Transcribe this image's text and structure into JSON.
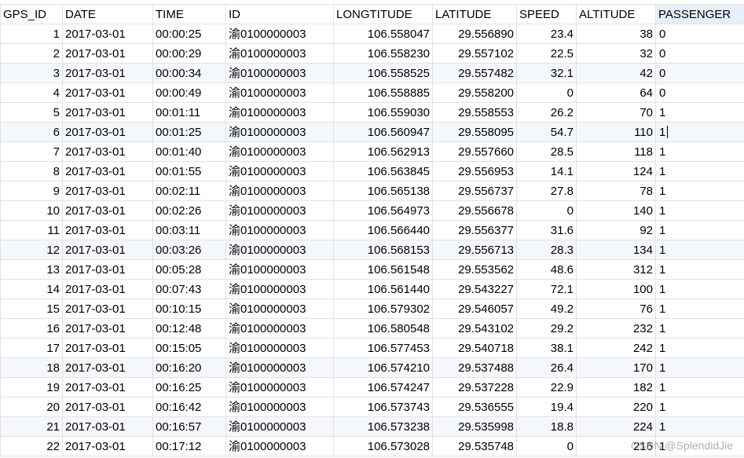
{
  "columns": [
    "GPS_ID",
    "DATE",
    "TIME",
    "ID",
    "LONGTITUDE",
    "LATITUDE",
    "SPEED",
    "ALTITUDE",
    "PASSENGER"
  ],
  "selected_column": "PASSENGER",
  "active_row_index": 5,
  "rows": [
    [
      "1",
      "2017-03-01",
      "00:00:25",
      "渝0100000003",
      "106.558047",
      "29.556890",
      "23.4",
      "38",
      "0"
    ],
    [
      "2",
      "2017-03-01",
      "00:00:29",
      "渝0100000003",
      "106.558230",
      "29.557102",
      "22.5",
      "32",
      "0"
    ],
    [
      "3",
      "2017-03-01",
      "00:00:34",
      "渝0100000003",
      "106.558525",
      "29.557482",
      "32.1",
      "42",
      "0"
    ],
    [
      "4",
      "2017-03-01",
      "00:00:49",
      "渝0100000003",
      "106.558885",
      "29.558200",
      "0",
      "64",
      "0"
    ],
    [
      "5",
      "2017-03-01",
      "00:01:11",
      "渝0100000003",
      "106.559030",
      "29.558553",
      "26.2",
      "70",
      "1"
    ],
    [
      "6",
      "2017-03-01",
      "00:01:25",
      "渝0100000003",
      "106.560947",
      "29.558095",
      "54.7",
      "110",
      "1"
    ],
    [
      "7",
      "2017-03-01",
      "00:01:40",
      "渝0100000003",
      "106.562913",
      "29.557660",
      "28.5",
      "118",
      "1"
    ],
    [
      "8",
      "2017-03-01",
      "00:01:55",
      "渝0100000003",
      "106.563845",
      "29.556953",
      "14.1",
      "124",
      "1"
    ],
    [
      "9",
      "2017-03-01",
      "00:02:11",
      "渝0100000003",
      "106.565138",
      "29.556737",
      "27.8",
      "78",
      "1"
    ],
    [
      "10",
      "2017-03-01",
      "00:02:26",
      "渝0100000003",
      "106.564973",
      "29.556678",
      "0",
      "140",
      "1"
    ],
    [
      "11",
      "2017-03-01",
      "00:03:11",
      "渝0100000003",
      "106.566440",
      "29.556377",
      "31.6",
      "92",
      "1"
    ],
    [
      "12",
      "2017-03-01",
      "00:03:26",
      "渝0100000003",
      "106.568153",
      "29.556713",
      "28.3",
      "134",
      "1"
    ],
    [
      "13",
      "2017-03-01",
      "00:05:28",
      "渝0100000003",
      "106.561548",
      "29.553562",
      "48.6",
      "312",
      "1"
    ],
    [
      "14",
      "2017-03-01",
      "00:07:43",
      "渝0100000003",
      "106.561440",
      "29.543227",
      "72.1",
      "100",
      "1"
    ],
    [
      "15",
      "2017-03-01",
      "00:10:15",
      "渝0100000003",
      "106.579302",
      "29.546057",
      "49.2",
      "76",
      "1"
    ],
    [
      "16",
      "2017-03-01",
      "00:12:48",
      "渝0100000003",
      "106.580548",
      "29.543102",
      "29.2",
      "232",
      "1"
    ],
    [
      "17",
      "2017-03-01",
      "00:15:05",
      "渝0100000003",
      "106.577453",
      "29.540718",
      "38.1",
      "242",
      "1"
    ],
    [
      "18",
      "2017-03-01",
      "00:16:20",
      "渝0100000003",
      "106.574210",
      "29.537488",
      "26.4",
      "170",
      "1"
    ],
    [
      "19",
      "2017-03-01",
      "00:16:25",
      "渝0100000003",
      "106.574247",
      "29.537228",
      "22.9",
      "182",
      "1"
    ],
    [
      "20",
      "2017-03-01",
      "00:16:42",
      "渝0100000003",
      "106.573743",
      "29.536555",
      "19.4",
      "220",
      "1"
    ],
    [
      "21",
      "2017-03-01",
      "00:16:57",
      "渝0100000003",
      "106.573238",
      "29.535998",
      "18.8",
      "224",
      "1"
    ],
    [
      "22",
      "2017-03-01",
      "00:17:12",
      "渝0100000003",
      "106.573028",
      "29.535748",
      "0",
      "216",
      "1"
    ]
  ],
  "watermark": "CSDN @SplendidJie",
  "colors": {
    "grid_line": "#e2e2e2",
    "alt_row": "#f4f7fc",
    "selected_header": "#e6eef9"
  }
}
